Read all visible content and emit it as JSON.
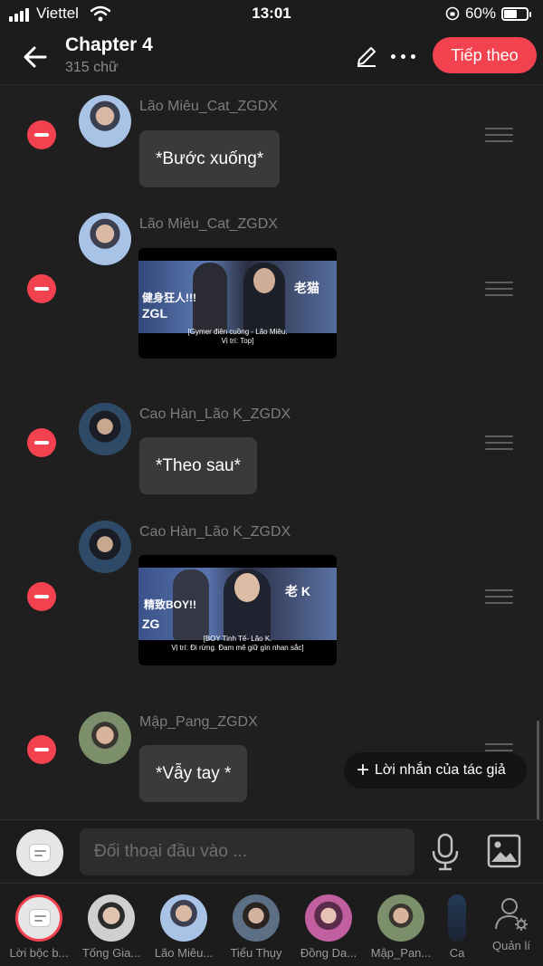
{
  "status_bar": {
    "carrier": "Viettel",
    "time": "13:01",
    "battery": "60%",
    "battery_level": 0.6
  },
  "header": {
    "title": "Chapter 4",
    "subtitle": "315 chữ",
    "next_label": "Tiếp theo"
  },
  "messages": [
    {
      "name": "Lão Miêu_Cat_ZGDX",
      "type": "text",
      "text": "*Bước xuống*"
    },
    {
      "name": "Lão Miêu_Cat_ZGDX",
      "type": "image",
      "overlay": "健身狂人!!!",
      "corner": "老猫",
      "logo": "ZGL",
      "caption_1": "[Gymer điên cuồng - Lão Miêu.",
      "caption_2": "Vị trí: Top]"
    },
    {
      "name": "Cao Hàn_Lão K_ZGDX",
      "type": "text",
      "text": "*Theo sau*"
    },
    {
      "name": "Cao Hàn_Lão K_ZGDX",
      "type": "image",
      "overlay": "精致BOY!!",
      "corner": "老 K",
      "logo": "ZG",
      "caption_1": "[BOY Tinh Tế- Lão K.",
      "caption_2": "Vị trí: Đi rừng. Đam mê giữ gìn nhan sắc]"
    },
    {
      "name": "Mập_Pang_ZGDX",
      "type": "text",
      "text": "*Vẫy tay *"
    }
  ],
  "author_note": {
    "label": "Lời nhắn của tác giả",
    "icon": "plus-icon"
  },
  "input": {
    "placeholder": "Đối thoại đầu vào ..."
  },
  "characters": [
    {
      "label": "Lời bộc b...",
      "active": true
    },
    {
      "label": "Tống Gia..."
    },
    {
      "label": "Lão Miêu..."
    },
    {
      "label": "Tiểu Thụy"
    },
    {
      "label": "Đồng Da..."
    },
    {
      "label": "Mập_Pan..."
    },
    {
      "label": "Ca"
    }
  ],
  "manage": {
    "label": "Quản lí"
  },
  "colors": {
    "accent": "#f2424f",
    "background": "#1f1f1f",
    "bubble": "#3a3a3a"
  }
}
